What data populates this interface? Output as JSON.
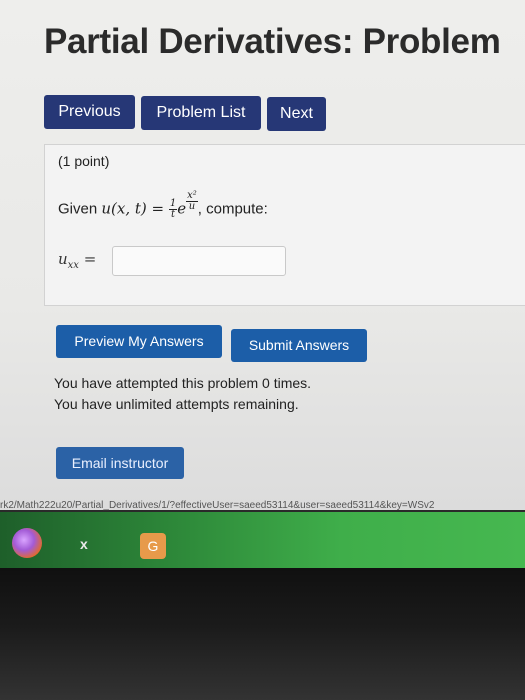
{
  "page_title": "Partial Derivatives: Problem",
  "nav": {
    "previous_label": "Previous",
    "problem_list_label": "Problem List",
    "next_label": "Next"
  },
  "problem": {
    "points": "(1 point)",
    "given_prefix": "Given ",
    "function_lhs": "u(x, t) = ",
    "frac_num": "1",
    "frac_den": "t",
    "exp_base": "e",
    "exp_num": "x²",
    "exp_den": "u",
    "given_suffix": ", compute:",
    "answer_label": "u",
    "answer_sub": "xx",
    "answer_eq": " =",
    "answer_value": ""
  },
  "actions": {
    "preview_label": "Preview My Answers",
    "submit_label": "Submit Answers"
  },
  "messages": {
    "attempted": "You have attempted this problem 0 times.",
    "remaining": "You have unlimited attempts remaining."
  },
  "email_label": "Email instructor",
  "status_url": "rk2/Math222u20/Partial_Derivatives/1/?effectiveUser=saeed53114&user=saeed53114&key=WSv2",
  "taskbar": {
    "close_glyph": "x"
  },
  "colors": {
    "nav_button": "#263776",
    "action_button": "#1c5ea8",
    "taskbar_green": "#2e8a3a"
  },
  "icons": [
    "firefox-icon",
    "close-icon",
    "app-icon"
  ]
}
